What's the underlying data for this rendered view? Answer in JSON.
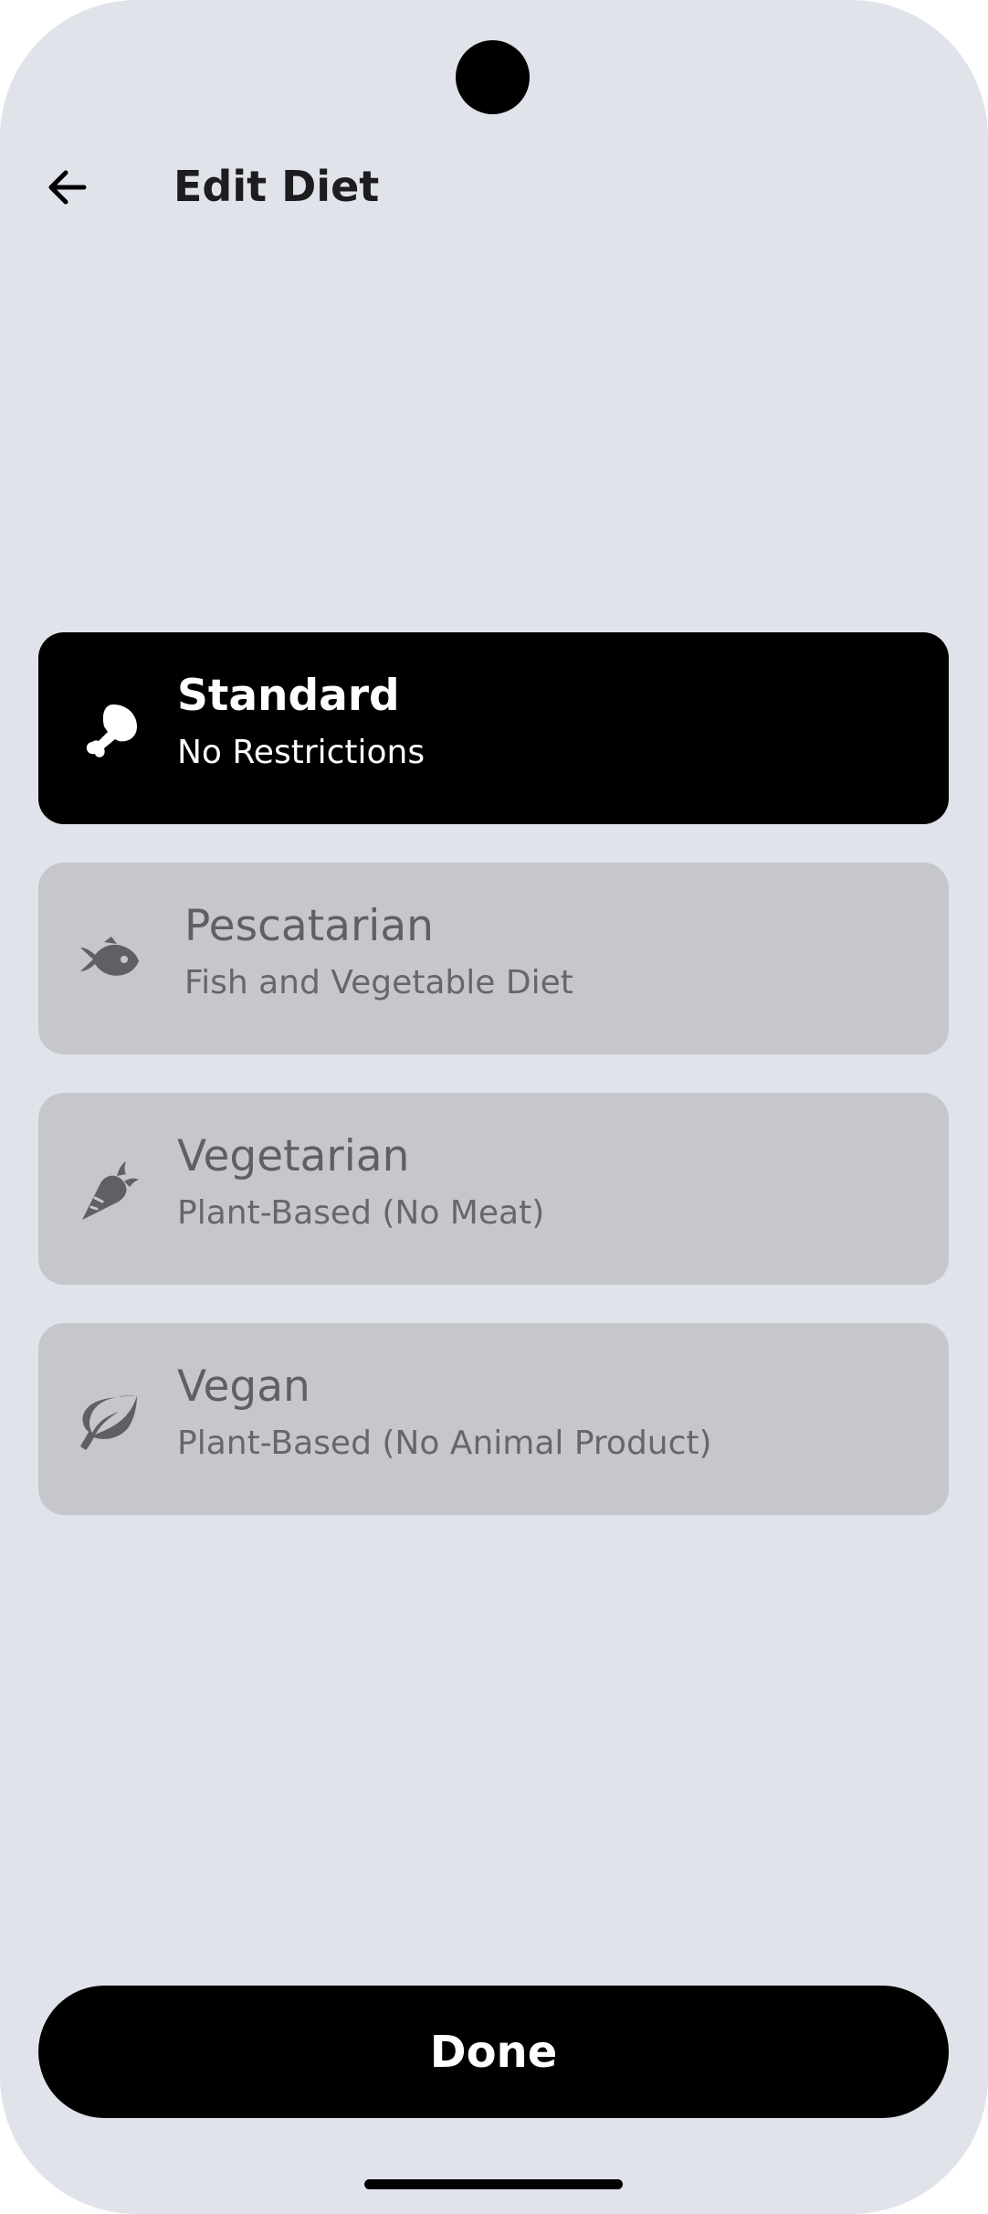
{
  "header": {
    "title": "Edit Diet",
    "back_icon": "arrow-left-icon"
  },
  "diet_options": [
    {
      "name": "Standard",
      "description": "No Restrictions",
      "icon": "drumstick-icon",
      "selected": true
    },
    {
      "name": "Pescatarian",
      "description": "Fish and Vegetable Diet",
      "icon": "fish-icon",
      "selected": false
    },
    {
      "name": "Vegetarian",
      "description": "Plant-Based (No Meat)",
      "icon": "carrot-icon",
      "selected": false
    },
    {
      "name": "Vegan",
      "description": "Plant-Based (No Animal Product)",
      "icon": "leaf-icon",
      "selected": false
    }
  ],
  "footer": {
    "done_label": "Done"
  },
  "colors": {
    "background": "#e1e3eb",
    "selected_card": "#000000",
    "unselected_card": "#c6c7cc",
    "unselected_text": "#5f6065",
    "button": "#000000"
  }
}
